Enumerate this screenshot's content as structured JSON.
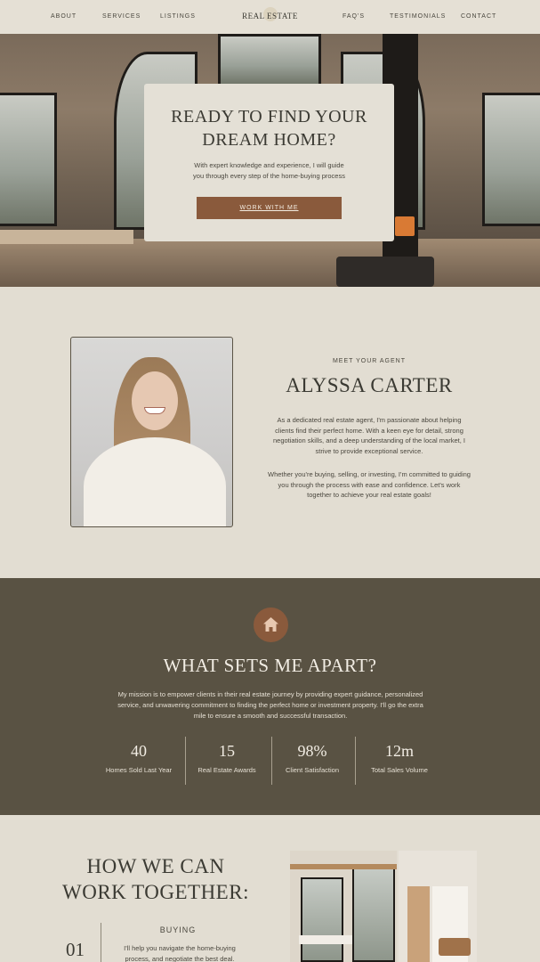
{
  "nav": {
    "left_items": [
      "ABOUT",
      "SERVICES",
      "LISTINGS"
    ],
    "brand": "REAL ESTATE",
    "right_items": [
      "FAQ'S",
      "TESTIMONIALS",
      "CONTACT"
    ]
  },
  "hero": {
    "title_line1": "READY TO FIND YOUR",
    "title_line2": "DREAM HOME?",
    "subtitle_line1": "With expert knowledge and experience, I will guide",
    "subtitle_line2": "you through every step of the home-buying process",
    "cta": "WORK WITH ME"
  },
  "agent": {
    "eyebrow": "MEET YOUR AGENT",
    "name": "ALYSSA CARTER",
    "bio1": "As a dedicated real estate agent, I'm passionate about helping clients find their perfect home. With a keen eye for detail, strong negotiation skills, and a deep understanding of the local market, I strive to provide exceptional service.",
    "bio2": "Whether you're buying, selling, or investing, I'm committed to guiding you through the process with ease and confidence. Let's work together to achieve your real estate goals!"
  },
  "apart": {
    "icon": "house-icon",
    "title": "WHAT SETS ME APART?",
    "text": "My mission is to empower clients in their real estate journey by providing expert guidance, personalized service, and unwavering commitment to finding the perfect home or investment property. I'll go the extra mile to ensure a smooth and successful transaction.",
    "stats": [
      {
        "value": "40",
        "label": "Homes Sold Last Year"
      },
      {
        "value": "15",
        "label": "Real Estate Awards"
      },
      {
        "value": "98%",
        "label": "Client Satisfaction"
      },
      {
        "value": "12m",
        "label": "Total Sales Volume"
      }
    ]
  },
  "work": {
    "title_line1": "HOW WE CAN",
    "title_line2": "WORK TOGETHER:",
    "step_label": "BUYING",
    "step_number": "01",
    "step_text": "I'll help you navigate the home-buying process, and negotiate the best deal."
  },
  "colors": {
    "background": "#e2ddd2",
    "accent": "#8a5a3c",
    "dark_section": "#595243",
    "text": "#3b3a33"
  }
}
